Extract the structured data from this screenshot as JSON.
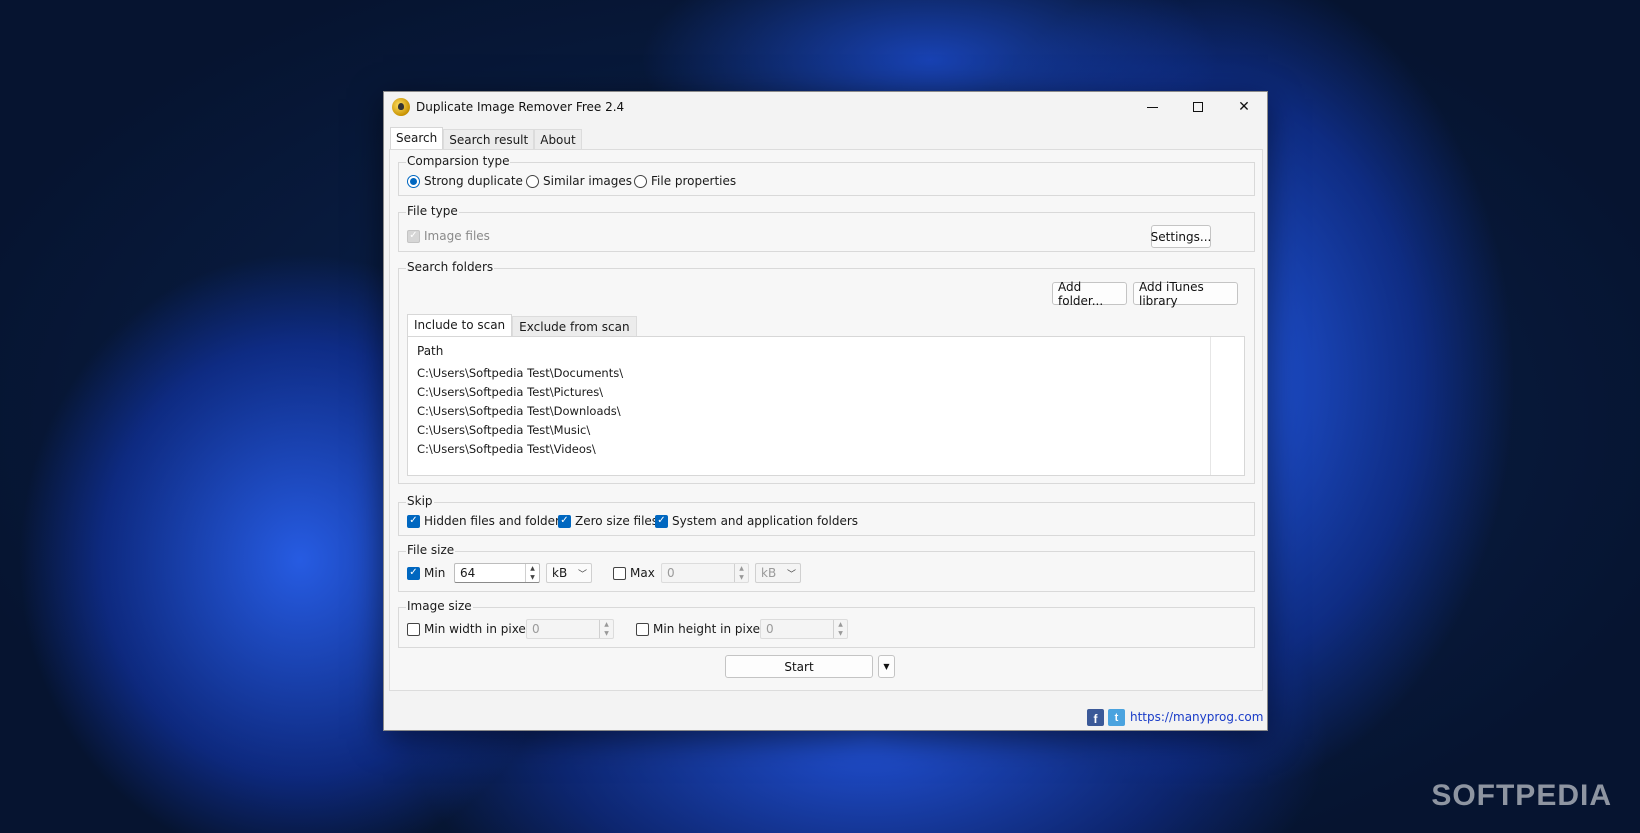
{
  "window": {
    "title": "Duplicate Image Remover Free 2.4",
    "controls": {
      "minimize": "—",
      "maximize": "□",
      "close": "✕"
    }
  },
  "tabs": [
    {
      "label": "Search",
      "active": true
    },
    {
      "label": "Search result",
      "active": false
    },
    {
      "label": "About",
      "active": false
    }
  ],
  "comparison": {
    "label": "Comparsion type",
    "options": [
      "Strong duplicate",
      "Similar images",
      "File properties"
    ],
    "selected": "Strong duplicate"
  },
  "file_type": {
    "label": "File type",
    "image_files_label": "Image files",
    "image_files_checked": true,
    "image_files_enabled": false,
    "settings_button": "Settings..."
  },
  "search_folders": {
    "label": "Search folders",
    "add_folder_button": "Add folder...",
    "add_itunes_button": "Add iTunes library",
    "tabs": [
      "Include to scan",
      "Exclude from scan"
    ],
    "column_header": "Path",
    "paths": [
      "C:\\Users\\Softpedia Test\\Documents\\",
      "C:\\Users\\Softpedia Test\\Pictures\\",
      "C:\\Users\\Softpedia Test\\Downloads\\",
      "C:\\Users\\Softpedia Test\\Music\\",
      "C:\\Users\\Softpedia Test\\Videos\\"
    ]
  },
  "skip": {
    "label": "Skip",
    "hidden_label": "Hidden files and folders",
    "zero_label": "Zero size files",
    "system_label": "System and application folders"
  },
  "file_size": {
    "label": "File size",
    "min_label": "Min",
    "min_value": "64",
    "min_unit": "kB",
    "max_label": "Max",
    "max_value": "0",
    "max_unit": "kB"
  },
  "image_size": {
    "label": "Image size",
    "min_width_label": "Min width in pixel",
    "min_width_value": "0",
    "min_height_label": "Min height in pixel",
    "min_height_value": "0"
  },
  "start_button": "Start",
  "footer": {
    "facebook": "f",
    "twitter": "t",
    "link": "https://manyprog.com"
  },
  "watermark": "SOFTPEDIA"
}
